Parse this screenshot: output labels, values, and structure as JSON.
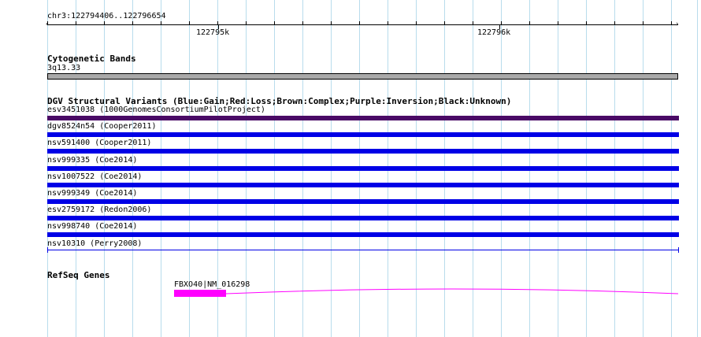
{
  "ruler": {
    "region": "chr3:122794406..122796654",
    "tick_labels": [
      "122795k",
      "122796k"
    ]
  },
  "cytoband": {
    "section_title": "Cytogenetic Bands",
    "band_label": "3q13.33",
    "color": "#a9a9a9"
  },
  "dgv": {
    "section_title": "DGV Structural Variants (Blue:Gain;Red:Loss;Brown:Complex;Purple:Inversion;Black:Unknown)",
    "variants": [
      {
        "label": "esv3451038 (1000GenomesConsortiumPilotProject)",
        "color": "#4a0a66",
        "style": "bar"
      },
      {
        "label": "dgv8524n54 (Cooper2011)",
        "color": "#0000e6",
        "style": "bar"
      },
      {
        "label": "nsv591400 (Cooper2011)",
        "color": "#0000e6",
        "style": "bar"
      },
      {
        "label": "nsv999335 (Coe2014)",
        "color": "#0000e6",
        "style": "bar"
      },
      {
        "label": "nsv1007522 (Coe2014)",
        "color": "#0000e6",
        "style": "bar"
      },
      {
        "label": "nsv999349 (Coe2014)",
        "color": "#0000e6",
        "style": "bar"
      },
      {
        "label": "esv2759172 (Redon2006)",
        "color": "#0000e6",
        "style": "bar"
      },
      {
        "label": "nsv998740 (Coe2014)",
        "color": "#0000e6",
        "style": "bar"
      },
      {
        "label": "nsv10310 (Perry2008)",
        "color": "#0000e6",
        "style": "thin"
      }
    ]
  },
  "refseq": {
    "section_title": "RefSeq Genes",
    "gene_label": "FBXO40|NM_016298",
    "color": "#ff00ff"
  }
}
